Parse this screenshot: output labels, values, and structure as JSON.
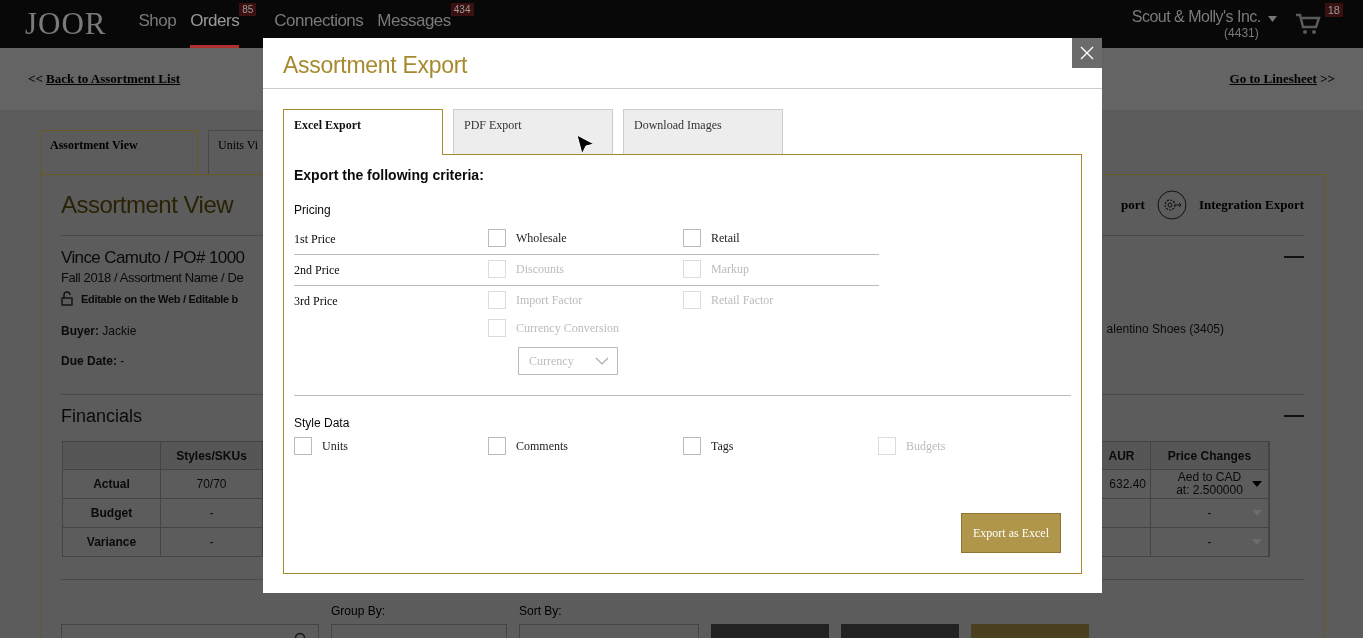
{
  "nav": {
    "logo": "JOOR",
    "items": [
      {
        "label": "Shop",
        "selected": false
      },
      {
        "label": "Orders",
        "selected": true,
        "badge": "85"
      },
      {
        "label": "Connections",
        "selected": false
      },
      {
        "label": "Messages",
        "selected": false,
        "badge": "434"
      }
    ],
    "account": {
      "name": "Scout & Molly's Inc.",
      "number": "(4431)"
    },
    "cart": {
      "count": "18"
    }
  },
  "crumbs": {
    "back_prefix": "<<",
    "back_link": "Back to Assortment List",
    "forward_link": "Go to Linesheet",
    "forward_suffix": ">>"
  },
  "view_tabs": [
    {
      "label": "Assortment View",
      "selected": true
    },
    {
      "label": "Units Vi",
      "selected": false
    }
  ],
  "assortment": {
    "title": "Assortment View",
    "actions": [
      {
        "label": "port",
        "kind": "text"
      },
      {
        "label": "Integration Export",
        "kind": "gear"
      }
    ],
    "order_title": "Vince Camuto / PO# 1000",
    "subtitle": "Fall 2018 / Assortment Name / De",
    "editable": "Editable on the Web / Editable b",
    "buyer_label": "Buyer:",
    "buyer": "Jackie",
    "due_label": "Due Date:",
    "due": "-",
    "brand": "alentino Shoes (3405)"
  },
  "financials": {
    "title": "Financials",
    "columns": [
      "Styles/SKUs",
      "AUR",
      "Price Changes"
    ],
    "rows": [
      {
        "label": "Actual",
        "cells": [
          "70/70",
          "632.40",
          "Aed to CAD at: 2.500000"
        ],
        "disabled": false
      },
      {
        "label": "Budget",
        "cells": [
          "-",
          "",
          "-"
        ],
        "disabled": true
      },
      {
        "label": "Variance",
        "cells": [
          "-",
          "",
          "-"
        ],
        "disabled": true
      }
    ]
  },
  "toolbar": {
    "group_label": "Group By:",
    "sort_label": "Sort By:",
    "buttons": [
      {
        "kind": "dark"
      },
      {
        "kind": "dark"
      },
      {
        "kind": "primary"
      }
    ]
  },
  "modal": {
    "title": "Assortment Export",
    "tabs": [
      {
        "label": "Excel Export",
        "selected": true
      },
      {
        "label": "PDF Export",
        "selected": false
      },
      {
        "label": "Download Images",
        "selected": false
      }
    ],
    "heading": "Export the following criteria:",
    "pricing": {
      "title": "Pricing",
      "rows": [
        {
          "label": "1st Price",
          "options": [
            {
              "label": "Wholesale",
              "checked": false,
              "disabled": false
            },
            {
              "label": "Retail",
              "checked": false,
              "disabled": false
            }
          ]
        },
        {
          "label": "2nd Price",
          "options": [
            {
              "label": "Discounts",
              "checked": false,
              "disabled": true
            },
            {
              "label": "Markup",
              "checked": false,
              "disabled": true
            }
          ]
        },
        {
          "label": "3rd Price",
          "options": [
            {
              "label": "Import Factor",
              "checked": false,
              "disabled": true
            },
            {
              "label": "Retail Factor",
              "checked": false,
              "disabled": true
            },
            {
              "label": "Currency Conversion",
              "checked": false,
              "disabled": true
            }
          ],
          "currency_select": {
            "placeholder": "Currency",
            "disabled": true
          }
        }
      ]
    },
    "style_data": {
      "title": "Style Data",
      "options": [
        {
          "label": "Units",
          "checked": false,
          "disabled": false
        },
        {
          "label": "Comments",
          "checked": false,
          "disabled": false
        },
        {
          "label": "Tags",
          "checked": false,
          "disabled": false
        },
        {
          "label": "Budgets",
          "checked": false,
          "disabled": true
        }
      ]
    },
    "export_button": "Export as Excel"
  }
}
